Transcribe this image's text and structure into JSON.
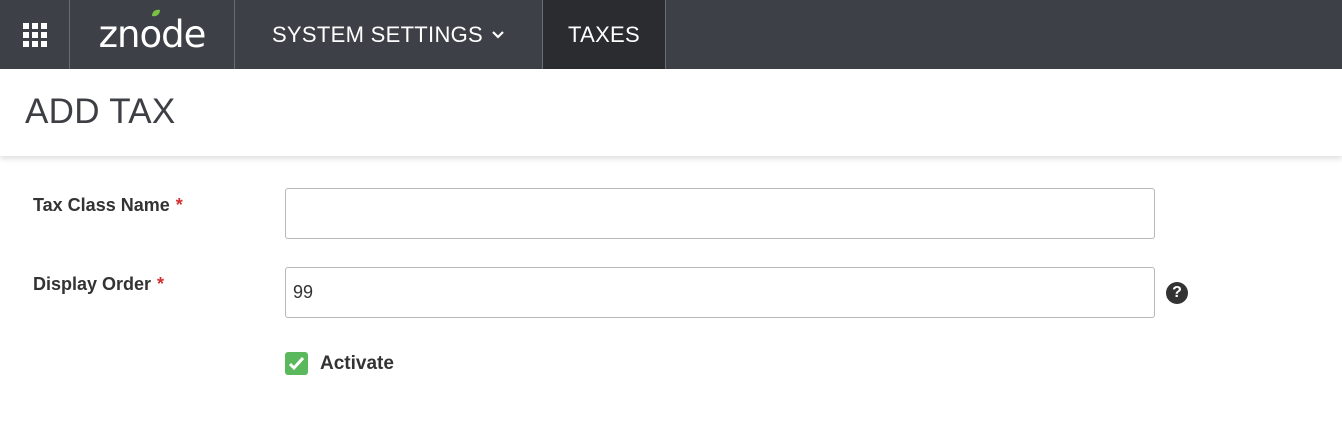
{
  "header": {
    "logo_text": "znode",
    "menu_label": "SYSTEM SETTINGS",
    "active_tab": "TAXES"
  },
  "page": {
    "title": "ADD TAX"
  },
  "form": {
    "tax_class_name": {
      "label": "Tax Class Name",
      "required_mark": "*",
      "value": ""
    },
    "display_order": {
      "label": "Display Order",
      "required_mark": "*",
      "value": "99"
    },
    "help_symbol": "?",
    "activate": {
      "label": "Activate",
      "checked": true
    }
  },
  "colors": {
    "topbar": "#3d4046",
    "active_tab": "#2a2c30",
    "required": "#d32f2f",
    "checkbox": "#5cb85c",
    "logo_leaf": "#7bc043"
  }
}
